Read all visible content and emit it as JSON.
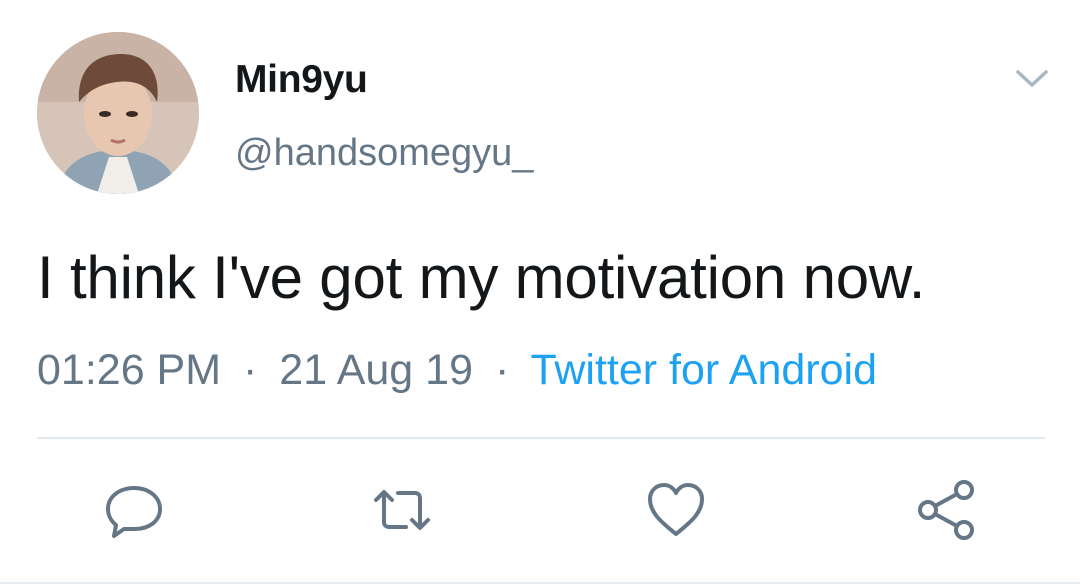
{
  "tweet": {
    "display_name": "Min9yu",
    "handle": "@handsomegyu_",
    "text": "I think I've got my motivation now.",
    "time": "01:26 PM",
    "date": "21 Aug 19",
    "separator": "·",
    "source": "Twitter for Android"
  },
  "icons": {
    "more": "chevron-down-icon",
    "reply": "reply-icon",
    "retweet": "retweet-icon",
    "like": "heart-icon",
    "share": "share-icon"
  },
  "colors": {
    "primary_text": "#14171a",
    "secondary_text": "#657786",
    "link": "#1da1f2",
    "divider": "#e1e8ed"
  }
}
